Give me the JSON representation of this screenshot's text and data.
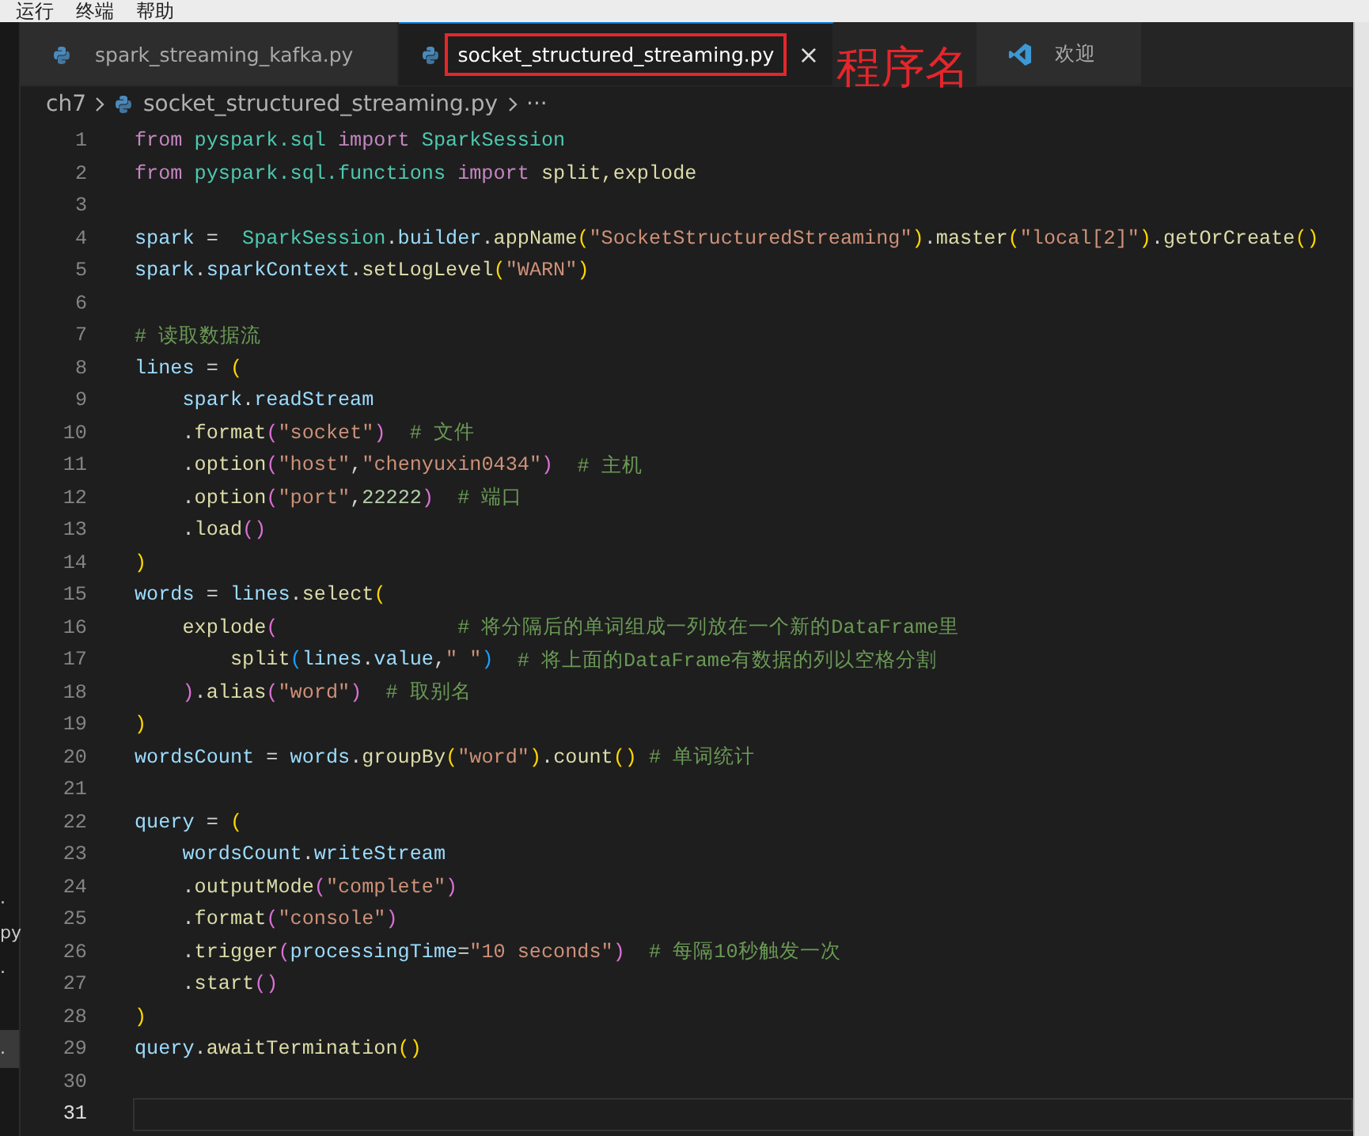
{
  "menu_bar": {
    "items": [
      "运行",
      "终端",
      "帮助"
    ]
  },
  "tabs": [
    {
      "label": "spark_streaming_kafka.py",
      "kind": "python",
      "selected": false,
      "annotated": false,
      "closable": false
    },
    {
      "label": "socket_structured_streaming.py",
      "kind": "python",
      "selected": true,
      "annotated": true,
      "closable": true,
      "close": "×"
    },
    {
      "label": "欢迎",
      "kind": "welcome",
      "selected": false,
      "annotated": false,
      "closable": false
    }
  ],
  "annotation": {
    "label": "程序名"
  },
  "breadcrumb": {
    "folder": "ch7",
    "file": "socket_structured_streaming.py",
    "more": "···"
  },
  "sidebar": {
    "items": [
      {
        "label": ".",
        "selected": false
      },
      {
        "label": "py",
        "selected": false
      },
      {
        "label": ".",
        "selected": false
      },
      {
        "label": ".",
        "selected": true
      }
    ]
  },
  "editor": {
    "lines": [
      {
        "number": "1",
        "current": false,
        "tokens": [
          {
            "kind": "keyword",
            "text": "from "
          },
          {
            "kind": "module",
            "text": "pyspark.sql "
          },
          {
            "kind": "keyword",
            "text": "import "
          },
          {
            "kind": "class",
            "text": "SparkSession"
          }
        ]
      },
      {
        "number": "2",
        "current": false,
        "tokens": [
          {
            "kind": "keyword",
            "text": "from "
          },
          {
            "kind": "module",
            "text": "pyspark.sql.functions "
          },
          {
            "kind": "keyword",
            "text": "import "
          },
          {
            "kind": "func",
            "text": "split,explode"
          }
        ]
      },
      {
        "number": "3",
        "current": false
      },
      {
        "number": "4",
        "current": false,
        "tokens": [
          {
            "kind": "var",
            "text": "spark"
          },
          {
            "kind": "plain",
            "text": " =  "
          },
          {
            "kind": "class",
            "text": "SparkSession"
          },
          {
            "kind": "plain",
            "text": "."
          },
          {
            "kind": "var",
            "text": "builder"
          },
          {
            "kind": "plain",
            "text": "."
          },
          {
            "kind": "func",
            "text": "appName"
          },
          {
            "kind": "paren1",
            "text": "("
          },
          {
            "kind": "string",
            "text": "\"SocketStructuredStreaming\""
          },
          {
            "kind": "paren1",
            "text": ")"
          },
          {
            "kind": "plain",
            "text": "."
          },
          {
            "kind": "func",
            "text": "master"
          },
          {
            "kind": "paren1",
            "text": "("
          },
          {
            "kind": "string",
            "text": "\"local[2]\""
          },
          {
            "kind": "paren1",
            "text": ")"
          },
          {
            "kind": "plain",
            "text": "."
          },
          {
            "kind": "func",
            "text": "getOrCreate"
          },
          {
            "kind": "paren1",
            "text": "()"
          }
        ]
      },
      {
        "number": "5",
        "current": false,
        "tokens": [
          {
            "kind": "var",
            "text": "spark"
          },
          {
            "kind": "plain",
            "text": "."
          },
          {
            "kind": "var",
            "text": "sparkContext"
          },
          {
            "kind": "plain",
            "text": "."
          },
          {
            "kind": "func",
            "text": "setLogLevel"
          },
          {
            "kind": "paren1",
            "text": "("
          },
          {
            "kind": "string",
            "text": "\"WARN\""
          },
          {
            "kind": "paren1",
            "text": ")"
          }
        ]
      },
      {
        "number": "6",
        "current": false
      },
      {
        "number": "7",
        "current": false,
        "tokens": [
          {
            "kind": "comment",
            "text": "# 读取数据流"
          }
        ]
      },
      {
        "number": "8",
        "current": false,
        "tokens": [
          {
            "kind": "var",
            "text": "lines"
          },
          {
            "kind": "plain",
            "text": " = "
          },
          {
            "kind": "paren1",
            "text": "("
          }
        ]
      },
      {
        "number": "9",
        "current": false,
        "tokens": [
          {
            "kind": "var",
            "text": "    spark"
          },
          {
            "kind": "plain",
            "text": "."
          },
          {
            "kind": "var",
            "text": "readStream"
          }
        ]
      },
      {
        "number": "10",
        "current": false,
        "tokens": [
          {
            "kind": "plain",
            "text": "    ."
          },
          {
            "kind": "func",
            "text": "format"
          },
          {
            "kind": "paren2",
            "text": "("
          },
          {
            "kind": "string",
            "text": "\"socket\""
          },
          {
            "kind": "paren2",
            "text": ")"
          },
          {
            "kind": "comment",
            "text": "  # 文件"
          }
        ]
      },
      {
        "number": "11",
        "current": false,
        "tokens": [
          {
            "kind": "plain",
            "text": "    ."
          },
          {
            "kind": "func",
            "text": "option"
          },
          {
            "kind": "paren2",
            "text": "("
          },
          {
            "kind": "string",
            "text": "\"host\""
          },
          {
            "kind": "plain",
            "text": ","
          },
          {
            "kind": "string",
            "text": "\"chenyuxin0434\""
          },
          {
            "kind": "paren2",
            "text": ")"
          },
          {
            "kind": "comment",
            "text": "  # 主机"
          }
        ]
      },
      {
        "number": "12",
        "current": false,
        "tokens": [
          {
            "kind": "plain",
            "text": "    ."
          },
          {
            "kind": "func",
            "text": "option"
          },
          {
            "kind": "paren2",
            "text": "("
          },
          {
            "kind": "string",
            "text": "\"port\""
          },
          {
            "kind": "plain",
            "text": ","
          },
          {
            "kind": "number",
            "text": "22222"
          },
          {
            "kind": "paren2",
            "text": ")"
          },
          {
            "kind": "comment",
            "text": "  # 端口"
          }
        ]
      },
      {
        "number": "13",
        "current": false,
        "tokens": [
          {
            "kind": "plain",
            "text": "    ."
          },
          {
            "kind": "func",
            "text": "load"
          },
          {
            "kind": "paren2",
            "text": "()"
          }
        ]
      },
      {
        "number": "14",
        "current": false,
        "tokens": [
          {
            "kind": "paren1",
            "text": ")"
          }
        ]
      },
      {
        "number": "15",
        "current": false,
        "tokens": [
          {
            "kind": "var",
            "text": "words"
          },
          {
            "kind": "plain",
            "text": " = "
          },
          {
            "kind": "var",
            "text": "lines"
          },
          {
            "kind": "plain",
            "text": "."
          },
          {
            "kind": "func",
            "text": "select"
          },
          {
            "kind": "paren1",
            "text": "("
          }
        ]
      },
      {
        "number": "16",
        "current": false,
        "tokens": [
          {
            "kind": "func",
            "text": "    explode"
          },
          {
            "kind": "paren2",
            "text": "("
          },
          {
            "kind": "comment",
            "text": "               # 将分隔后的单词组成一列放在一个新的DataFrame里"
          }
        ]
      },
      {
        "number": "17",
        "current": false,
        "tokens": [
          {
            "kind": "func",
            "text": "        split"
          },
          {
            "kind": "paren3",
            "text": "("
          },
          {
            "kind": "var",
            "text": "lines"
          },
          {
            "kind": "plain",
            "text": "."
          },
          {
            "kind": "var",
            "text": "value"
          },
          {
            "kind": "plain",
            "text": ","
          },
          {
            "kind": "string",
            "text": "\" \""
          },
          {
            "kind": "paren3",
            "text": ")"
          },
          {
            "kind": "comment",
            "text": "  # 将上面的DataFrame有数据的列以空格分割"
          }
        ]
      },
      {
        "number": "18",
        "current": false,
        "tokens": [
          {
            "kind": "paren2",
            "text": "    )"
          },
          {
            "kind": "plain",
            "text": "."
          },
          {
            "kind": "func",
            "text": "alias"
          },
          {
            "kind": "paren2",
            "text": "("
          },
          {
            "kind": "string",
            "text": "\"word\""
          },
          {
            "kind": "paren2",
            "text": ")"
          },
          {
            "kind": "comment",
            "text": "  # 取别名"
          }
        ]
      },
      {
        "number": "19",
        "current": false,
        "tokens": [
          {
            "kind": "paren1",
            "text": ")"
          }
        ]
      },
      {
        "number": "20",
        "current": false,
        "tokens": [
          {
            "kind": "var",
            "text": "wordsCount"
          },
          {
            "kind": "plain",
            "text": " = "
          },
          {
            "kind": "var",
            "text": "words"
          },
          {
            "kind": "plain",
            "text": "."
          },
          {
            "kind": "func",
            "text": "groupBy"
          },
          {
            "kind": "paren1",
            "text": "("
          },
          {
            "kind": "string",
            "text": "\"word\""
          },
          {
            "kind": "paren1",
            "text": ")"
          },
          {
            "kind": "plain",
            "text": "."
          },
          {
            "kind": "func",
            "text": "count"
          },
          {
            "kind": "paren1",
            "text": "()"
          },
          {
            "kind": "comment",
            "text": " # 单词统计"
          }
        ]
      },
      {
        "number": "21",
        "current": false
      },
      {
        "number": "22",
        "current": false,
        "tokens": [
          {
            "kind": "var",
            "text": "query"
          },
          {
            "kind": "plain",
            "text": " = "
          },
          {
            "kind": "paren1",
            "text": "("
          }
        ]
      },
      {
        "number": "23",
        "current": false,
        "tokens": [
          {
            "kind": "var",
            "text": "    wordsCount"
          },
          {
            "kind": "plain",
            "text": "."
          },
          {
            "kind": "var",
            "text": "writeStream"
          }
        ]
      },
      {
        "number": "24",
        "current": false,
        "tokens": [
          {
            "kind": "plain",
            "text": "    ."
          },
          {
            "kind": "func",
            "text": "outputMode"
          },
          {
            "kind": "paren2",
            "text": "("
          },
          {
            "kind": "string",
            "text": "\"complete\""
          },
          {
            "kind": "paren2",
            "text": ")"
          }
        ]
      },
      {
        "number": "25",
        "current": false,
        "tokens": [
          {
            "kind": "plain",
            "text": "    ."
          },
          {
            "kind": "func",
            "text": "format"
          },
          {
            "kind": "paren2",
            "text": "("
          },
          {
            "kind": "string",
            "text": "\"console\""
          },
          {
            "kind": "paren2",
            "text": ")"
          }
        ]
      },
      {
        "number": "26",
        "current": false,
        "tokens": [
          {
            "kind": "plain",
            "text": "    ."
          },
          {
            "kind": "func",
            "text": "trigger"
          },
          {
            "kind": "paren2",
            "text": "("
          },
          {
            "kind": "var",
            "text": "processingTime"
          },
          {
            "kind": "plain",
            "text": "="
          },
          {
            "kind": "string",
            "text": "\"10 seconds\""
          },
          {
            "kind": "paren2",
            "text": ")"
          },
          {
            "kind": "comment",
            "text": "  # 每隔10秒触发一次"
          }
        ]
      },
      {
        "number": "27",
        "current": false,
        "tokens": [
          {
            "kind": "plain",
            "text": "    ."
          },
          {
            "kind": "func",
            "text": "start"
          },
          {
            "kind": "paren2",
            "text": "()"
          }
        ]
      },
      {
        "number": "28",
        "current": false,
        "tokens": [
          {
            "kind": "paren1",
            "text": ")"
          }
        ]
      },
      {
        "number": "29",
        "current": false,
        "tokens": [
          {
            "kind": "var",
            "text": "query"
          },
          {
            "kind": "plain",
            "text": "."
          },
          {
            "kind": "func",
            "text": "awaitTermination"
          },
          {
            "kind": "paren1",
            "text": "()"
          }
        ]
      },
      {
        "number": "30",
        "current": false
      },
      {
        "number": "31",
        "current": true
      }
    ]
  }
}
